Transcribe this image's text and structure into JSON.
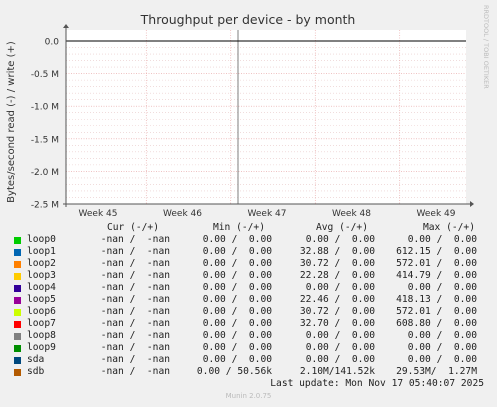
{
  "chart_data": {
    "type": "line",
    "title": "Throughput per device - by month",
    "ylabel": "Bytes/second read (-) / write (+)",
    "side_label": "RRDTOOL / TOBI OETIKER",
    "y_ticks": [
      "0.0",
      "-0.5 M",
      "-1.0 M",
      "-1.5 M",
      "-2.0 M",
      "-2.5 M"
    ],
    "y_tick_values": [
      0,
      -500000,
      -1000000,
      -1500000,
      -2000000,
      -2500000
    ],
    "ylim": [
      -2500000,
      100000
    ],
    "x_ticks": [
      "Week 45",
      "Week 46",
      "Week 47",
      "Week 48",
      "Week 49"
    ],
    "grid": true,
    "colors": {
      "background": "#f0f0f0",
      "plot_bg": "#ffffff",
      "grid_major": "#e6a0a0",
      "zero_line": "#000000",
      "now_line": "#7f7f7f"
    },
    "series": [
      {
        "name": "loop0",
        "color": "#00cc00",
        "values": [
          0,
          0
        ]
      },
      {
        "name": "loop1",
        "color": "#0066b3",
        "values": [
          0,
          0
        ]
      },
      {
        "name": "loop2",
        "color": "#ff8000",
        "values": [
          0,
          0
        ]
      },
      {
        "name": "loop3",
        "color": "#ffcc00",
        "values": [
          0,
          0
        ]
      },
      {
        "name": "loop4",
        "color": "#330099",
        "values": [
          0,
          0
        ]
      },
      {
        "name": "loop5",
        "color": "#990099",
        "values": [
          0,
          0
        ]
      },
      {
        "name": "loop6",
        "color": "#ccff00",
        "values": [
          0,
          0
        ]
      },
      {
        "name": "loop7",
        "color": "#ff0000",
        "values": [
          0,
          0
        ]
      },
      {
        "name": "loop8",
        "color": "#808080",
        "values": [
          0,
          0
        ]
      },
      {
        "name": "loop9",
        "color": "#008f00",
        "values": [
          0,
          0
        ]
      },
      {
        "name": "sda",
        "color": "#00487d",
        "values": [
          0,
          0
        ]
      },
      {
        "name": "sdb",
        "color": "#b35a00",
        "values": [
          0,
          0
        ]
      }
    ]
  },
  "legend": {
    "headers": {
      "cur": "Cur (-/+)",
      "min": "Min (-/+)",
      "avg": "Avg (-/+)",
      "max": "Max (-/+)"
    },
    "rows": [
      {
        "name": "loop0",
        "cur": "-nan /  -nan",
        "min": "0.00 /  0.00",
        "avg": "0.00 /  0.00",
        "max": "0.00 /  0.00"
      },
      {
        "name": "loop1",
        "cur": "-nan /  -nan",
        "min": "0.00 /  0.00",
        "avg": "32.88 /  0.00",
        "max": "612.15 /  0.00"
      },
      {
        "name": "loop2",
        "cur": "-nan /  -nan",
        "min": "0.00 /  0.00",
        "avg": "30.72 /  0.00",
        "max": "572.01 /  0.00"
      },
      {
        "name": "loop3",
        "cur": "-nan /  -nan",
        "min": "0.00 /  0.00",
        "avg": "22.28 /  0.00",
        "max": "414.79 /  0.00"
      },
      {
        "name": "loop4",
        "cur": "-nan /  -nan",
        "min": "0.00 /  0.00",
        "avg": "0.00 /  0.00",
        "max": "0.00 /  0.00"
      },
      {
        "name": "loop5",
        "cur": "-nan /  -nan",
        "min": "0.00 /  0.00",
        "avg": "22.46 /  0.00",
        "max": "418.13 /  0.00"
      },
      {
        "name": "loop6",
        "cur": "-nan /  -nan",
        "min": "0.00 /  0.00",
        "avg": "30.72 /  0.00",
        "max": "572.01 /  0.00"
      },
      {
        "name": "loop7",
        "cur": "-nan /  -nan",
        "min": "0.00 /  0.00",
        "avg": "32.70 /  0.00",
        "max": "608.80 /  0.00"
      },
      {
        "name": "loop8",
        "cur": "-nan /  -nan",
        "min": "0.00 /  0.00",
        "avg": "0.00 /  0.00",
        "max": "0.00 /  0.00"
      },
      {
        "name": "loop9",
        "cur": "-nan /  -nan",
        "min": "0.00 /  0.00",
        "avg": "0.00 /  0.00",
        "max": "0.00 /  0.00"
      },
      {
        "name": "sda",
        "cur": "-nan /  -nan",
        "min": "0.00 /  0.00",
        "avg": "0.00 /  0.00",
        "max": "0.00 /  0.00"
      },
      {
        "name": "sdb",
        "cur": "-nan /  -nan",
        "min": "0.00 / 50.56k",
        "avg": "2.10M/141.52k",
        "max": "29.53M/  1.27M"
      }
    ]
  },
  "footer": {
    "last_update": "Last update: Mon Nov 17 05:40:07 2025",
    "version": "Munin 2.0.75"
  }
}
